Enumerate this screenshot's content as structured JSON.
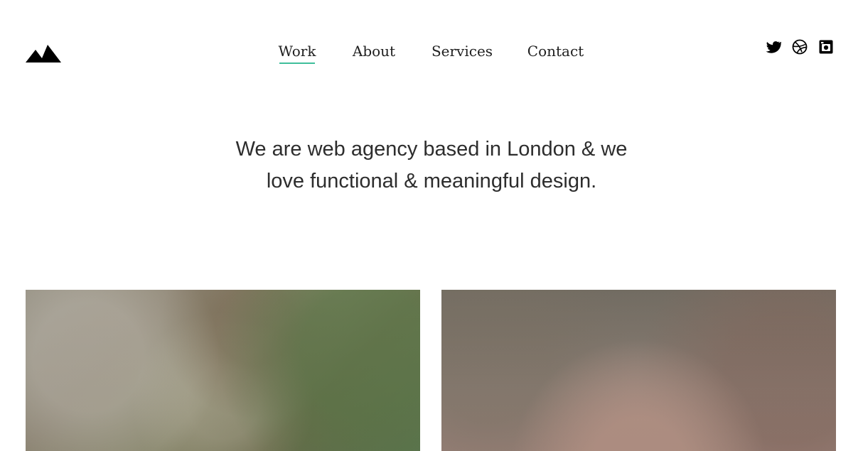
{
  "header": {
    "logo_icon": "mountains-icon",
    "nav": [
      {
        "label": "Work",
        "active": true
      },
      {
        "label": "About",
        "active": false
      },
      {
        "label": "Services",
        "active": false
      },
      {
        "label": "Contact",
        "active": false
      }
    ],
    "active_accent": "#3fbe9b",
    "social": [
      {
        "icon": "twitter-icon"
      },
      {
        "icon": "dribbble-icon"
      },
      {
        "icon": "instagram-icon"
      }
    ]
  },
  "hero": {
    "line_1": "We are web agency based in London & we",
    "line_2": "love functional & meaningful design."
  },
  "gallery": {
    "cards": [
      {
        "image": "blurred-photo-green"
      },
      {
        "image": "blurred-photo-pink"
      }
    ]
  }
}
